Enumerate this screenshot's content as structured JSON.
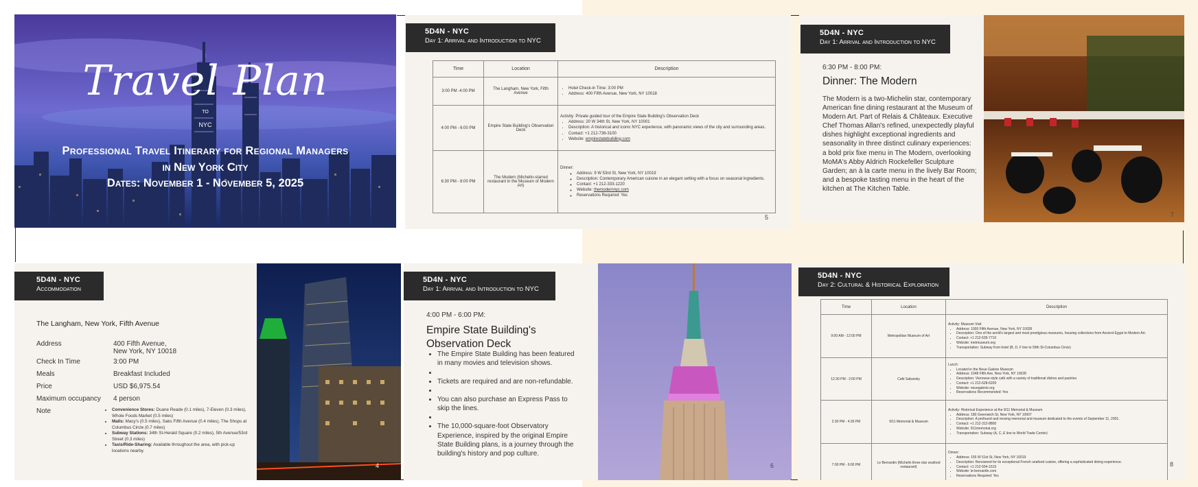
{
  "slide1": {
    "title": "Travel Plan",
    "to": "TO",
    "nyc": "NYC",
    "subtitle_line1": "Professional Travel Itinerary for Regional Managers",
    "subtitle_line2": "in New York City",
    "dates": "Dates: November 1 - November 5, 2025"
  },
  "slide5": {
    "header_title": "5D4N - NYC",
    "header_sub": "Day 1: Arrival and Introduction to NYC",
    "page": "5",
    "columns": [
      "Time",
      "Location",
      "Description"
    ],
    "rows": [
      {
        "time": "3:00 PM -4:00 PM",
        "location": "The Langham, New York, Fifth Avenue",
        "bullets": [
          "Hotel Check-in Time: 3:00 PM",
          "Address: 400 Fifth Avenue, New York, NY 10018"
        ]
      },
      {
        "time": "4:00 PM - 6:00 PM",
        "location": "Empire State Building's Observation Deck",
        "activity": "Activity: Private guided tour of the Empire State Building's Observation Deck",
        "bullets": [
          "Address: 20 W 34th St, New York, NY 10001",
          "Description: A historical and iconic NYC experience, with panoramic views of the city and surrounding areas.",
          "Contact: +1 212-736-3100"
        ],
        "website_label": "Website: ",
        "website": "empirestatebuilding.com"
      },
      {
        "time": "6:30 PM - 8:00 PM",
        "location": "The Modern (Michelin-starred restaurant in the Museum of Modern Art)",
        "activity": "Dinner:",
        "bullets": [
          "Address: 9 W 53rd St, New York, NY 10019",
          "Description: Contemporary American cuisine in an elegant setting with a focus on seasonal ingredients.",
          "Contact: +1 212-333-1220"
        ],
        "website_label": "Website: ",
        "website": "themodernnyc.com",
        "reservation": "Reservations Required: Yes"
      }
    ]
  },
  "slide7": {
    "header_title": "5D4N - NYC",
    "header_sub": "Day 1: Arrival and Introduction to NYC",
    "time": "6:30 PM - 8:00 PM:",
    "heading": "Dinner: The Modern",
    "body": "The Modern is a two-Michelin star, contemporary American fine dining restaurant at the Museum of Modern Art. Part of Relais & Châteaux. Executive Chef Thomas Allan's refined, unexpectedly playful dishes highlight exceptional ingredients and seasonality in three distinct culinary experiences: a bold prix fixe menu in The Modern, overlooking MoMA's Abby Aldrich Rockefeller Sculpture Garden; an à la carte menu in the lively Bar Room; and a bespoke tasting menu in the heart of the kitchen at The Kitchen Table.",
    "page": "7"
  },
  "slide4": {
    "header_title": "5D4N - NYC",
    "header_sub": "Accommodation",
    "hotel": "The Langham, New York, Fifth Avenue",
    "address_label": "Address",
    "address_line1": "400 Fifth Avenue,",
    "address_line2": "New York, NY 10018",
    "checkin_label": "Check In Time",
    "checkin": "3:00 PM",
    "meals_label": "Meals",
    "meals": "Breakfast Included",
    "price_label": "Price",
    "price": "USD $6,975.54",
    "occupancy_label": "Maximum occupancy",
    "occupancy": "4  person",
    "note_label": "Note",
    "notes": [
      {
        "label": "Convenience Stores:",
        "text": " Duane Reade (0.1 miles), 7-Eleven (0.3 miles), Whole Foods Market (0.5 miles)"
      },
      {
        "label": "Malls:",
        "text": " Macy's (0.5 miles), Saks Fifth Avenue (0.4 miles), The Shops at Columbus Circle (0.7 miles)"
      },
      {
        "label": "Subway Stations:",
        "text": " 34th St-Herald Square (0.2 miles), 5th Avenue/53rd Street (0.3 miles)"
      },
      {
        "label": "Taxis/Ride-Sharing:",
        "text": " Available throughout the area, with pick-up locations nearby."
      }
    ],
    "page": "4"
  },
  "slide6": {
    "header_title": "5D4N - NYC",
    "header_sub": "Day 1: Arrival and Introduction to NYC",
    "time": "4:00 PM - 6:00 PM:",
    "heading_line1": "Empire State Building's",
    "heading_line2": "Observation Deck",
    "bullets": [
      "The Empire State Building has been featured in many movies and television shows.",
      "",
      "Tickets are required and are non-refundable.",
      "",
      "You can also purchase an Express Pass to skip the lines.",
      "",
      "The 10,000-square-foot Observatory Experience, inspired by the original Empire State Building plans, is a journey through the building's history and pop culture."
    ],
    "page": "6"
  },
  "slide8": {
    "header_title": "5D4N - NYC",
    "header_sub": "Day 2: Cultural & Historical Exploration",
    "page": "8",
    "columns": [
      "Time",
      "Location",
      "Description"
    ],
    "rows": [
      {
        "time": "9:00 AM - 12:00 PM",
        "location": "Metropolitan Museum of Art",
        "activity": "Activity: Museum Visit",
        "bullets": [
          "Address: 1000 Fifth Avenue, New York, NY 10028",
          "Description: One of the world's largest and most prestigious museums, housing collections from Ancient Egypt to Modern Art.",
          "Contact: +1 212-535-7710",
          "Website: metmuseum.org",
          "Transportation: Subway from hotel (B, D, F line to 59th St-Columbus Circle)"
        ]
      },
      {
        "time": "12:30 PM - 2:00 PM",
        "location": "Café Sabarsky",
        "activity": "Lunch:",
        "bullets": [
          "Located in the Neue Galerie Museum",
          "Address: 1048 Fifth Ave, New York, NY 10028",
          "Description: Viennese-style café with a variety of traditional dishes and pastries.",
          "Contact: +1 212-628-6200",
          "Website: neuegalerie.org",
          "Reservations Recommended: Yes"
        ]
      },
      {
        "time": "2:30 PM - 4:30 PM",
        "location": "9/11 Memorial & Museum",
        "activity": "Activity: Historical Experience at the 9/11 Memorial & Museum",
        "bullets": [
          "Address: 180 Greenwich St, New York, NY 10007",
          "Description: A profound and moving memorial and museum dedicated to the events of September 11, 2001.",
          "Contact: +1 212-312-8800",
          "Website: 911memorial.org",
          "Transportation: Subway (A, C, E line to World Trade Center)"
        ]
      },
      {
        "time": "7:00 PM - 9:00 PM",
        "location": "Le Bernardin (Michelin three-star seafood restaurant)",
        "activity": "Dinner:",
        "bullets": [
          "Address: 155 W 51st St, New York, NY 10019",
          "Description: Renowned for its exceptional French seafood cuisine, offering a sophisticated dining experience.",
          "Contact: +1 212-554-1515",
          "Website: le-bernardin.com",
          "Reservations Required: Yes"
        ]
      }
    ]
  }
}
